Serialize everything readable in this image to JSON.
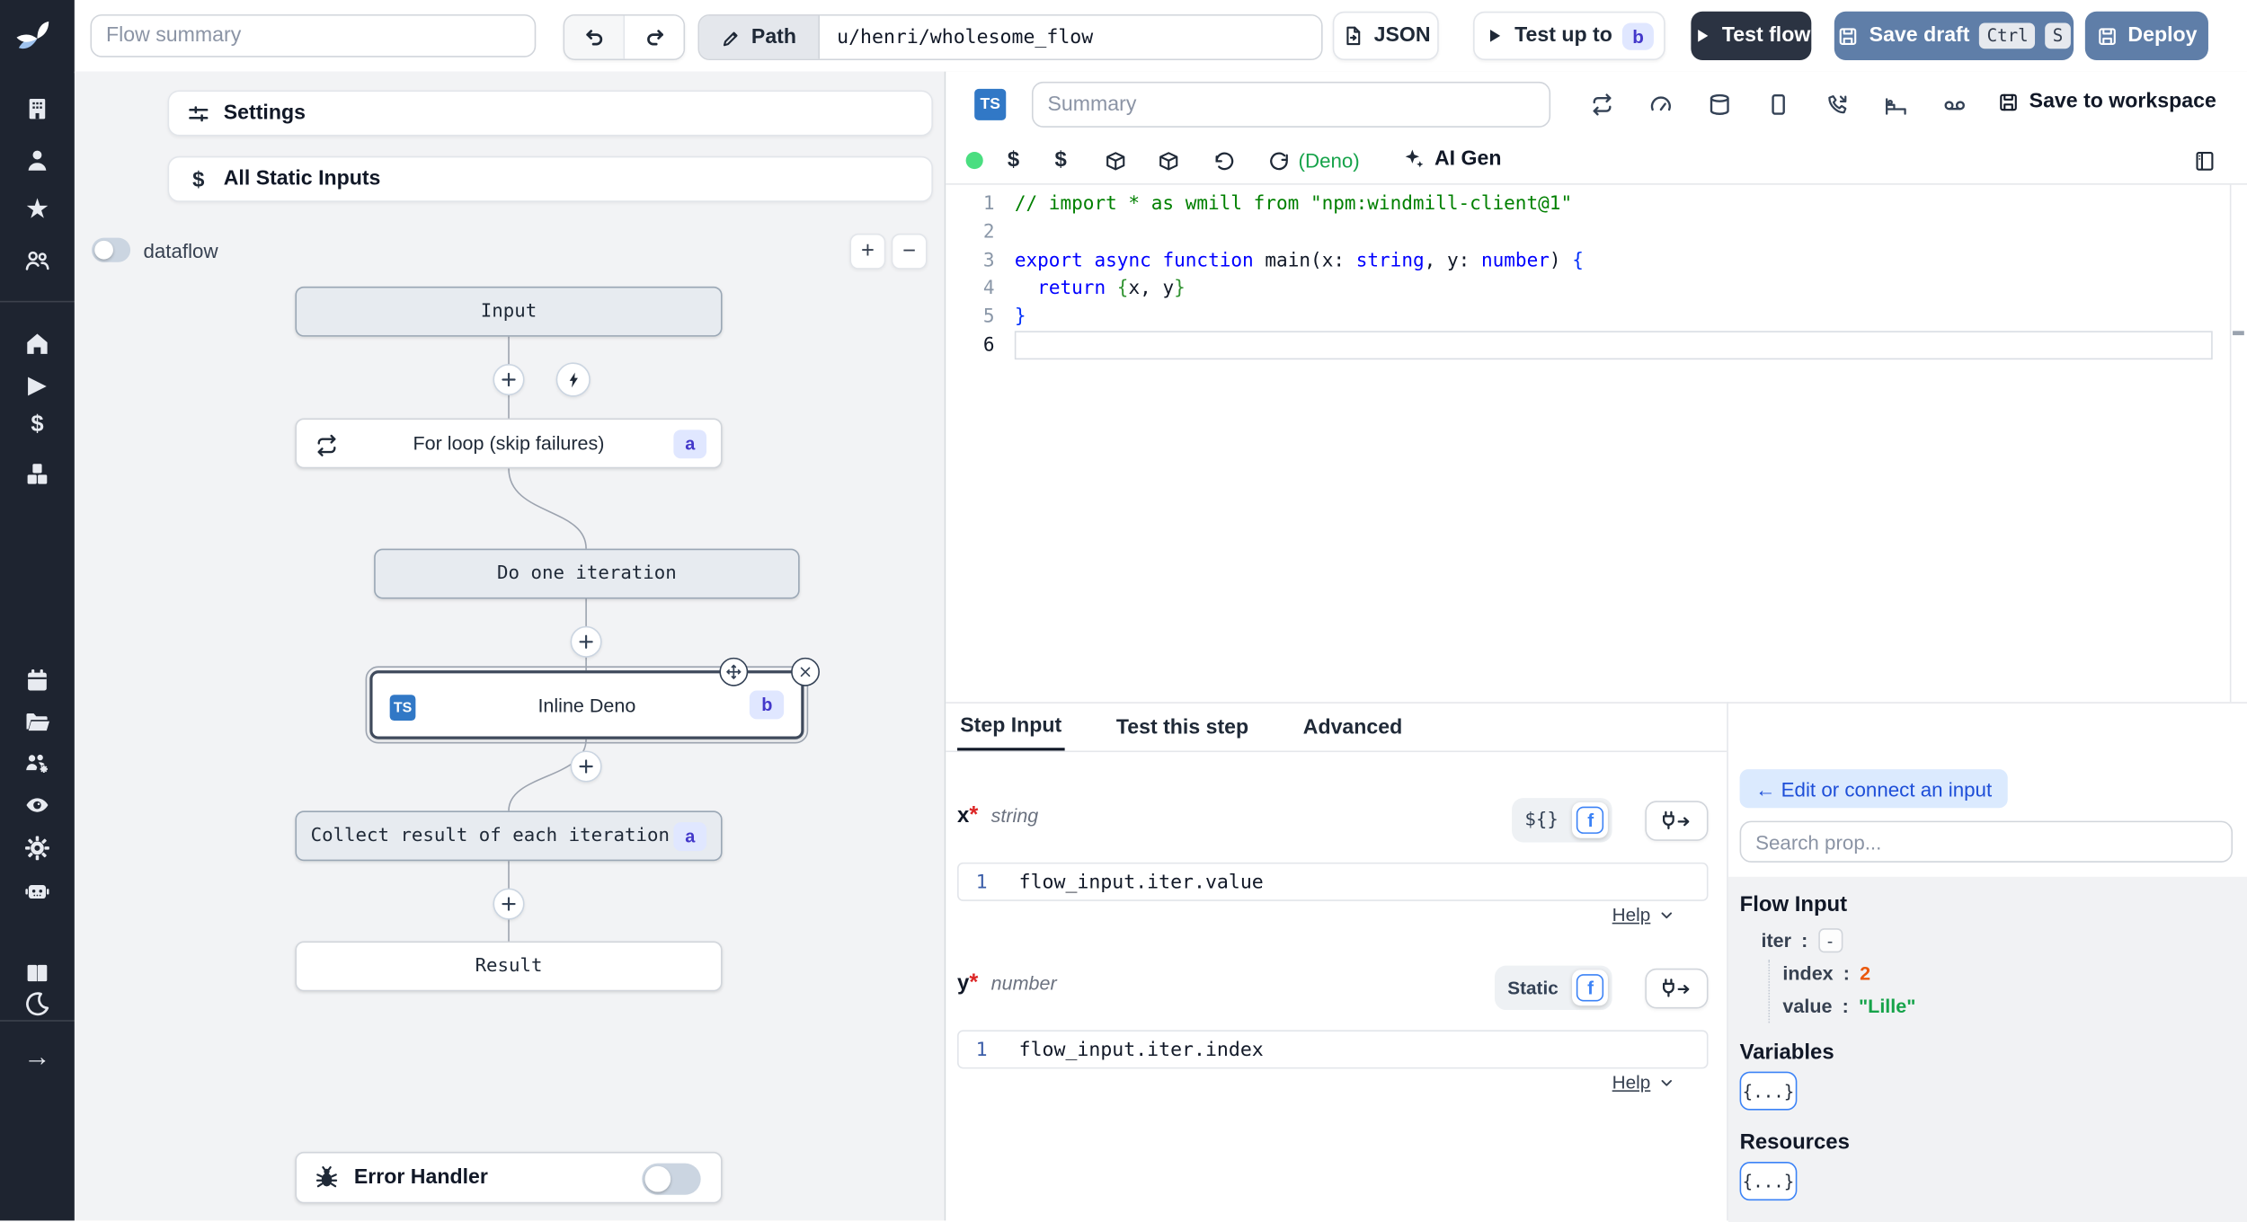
{
  "colors": {
    "accent_blue": "#3178c6",
    "button_blue": "#5f7ea8",
    "dark_button": "#2b3342",
    "badge_bg": "#e0e7ff",
    "badge_text": "#4338ca",
    "connect_bg": "#dbeafe",
    "connect_text": "#1d4ed8",
    "num_value": "#ea580c",
    "str_value": "#16a34a",
    "sidebar_bg": "#1e2430"
  },
  "topbar": {
    "flow_summary_placeholder": "Flow summary",
    "path_label": "Path",
    "path_value": "u/henri/wholesome_flow",
    "json_label": "JSON",
    "test_up_to_label": "Test up to",
    "test_up_to_badge": "b",
    "test_flow_label": "Test flow",
    "save_draft_label": "Save draft",
    "kbd": [
      "Ctrl",
      "S"
    ],
    "deploy_label": "Deploy"
  },
  "flow_panel": {
    "settings_label": "Settings",
    "static_inputs_label": "All Static Inputs",
    "dataflow_label": "dataflow",
    "zoom_in": "+",
    "zoom_out": "−",
    "nodes": {
      "input": "Input",
      "for_loop": "For loop (skip failures)",
      "for_loop_badge": "a",
      "do_one": "Do one iteration",
      "inline": "Inline Deno",
      "inline_badge": "b",
      "inline_lang": "TS",
      "collect": "Collect result of each iteration",
      "collect_badge": "a",
      "result": "Result"
    },
    "error_handler_label": "Error Handler"
  },
  "editor": {
    "lang_badge": "TS",
    "summary_placeholder": "Summary",
    "save_to_workspace": "Save to workspace",
    "runtime": "(Deno)",
    "ai_gen": "AI Gen",
    "code_lines": [
      {
        "n": "1",
        "tokens": [
          {
            "t": "// import * as wmill from \"npm:windmill-client@1\"",
            "c": "c-com"
          }
        ]
      },
      {
        "n": "2",
        "tokens": []
      },
      {
        "n": "3",
        "tokens": [
          {
            "t": "export",
            "c": "c-kw"
          },
          {
            "t": " ",
            "c": "c-pl"
          },
          {
            "t": "async",
            "c": "c-kw"
          },
          {
            "t": " ",
            "c": "c-pl"
          },
          {
            "t": "function",
            "c": "c-kw"
          },
          {
            "t": " main(x: ",
            "c": "c-pl"
          },
          {
            "t": "string",
            "c": "c-ty"
          },
          {
            "t": ", y: ",
            "c": "c-pl"
          },
          {
            "t": "number",
            "c": "c-ty"
          },
          {
            "t": ") ",
            "c": "c-pl"
          },
          {
            "t": "{",
            "c": "c-b1"
          }
        ]
      },
      {
        "n": "4",
        "tokens": [
          {
            "t": "  ",
            "c": "c-pl"
          },
          {
            "t": "return",
            "c": "c-kw"
          },
          {
            "t": " ",
            "c": "c-pl"
          },
          {
            "t": "{",
            "c": "c-b2"
          },
          {
            "t": "x, y",
            "c": "c-pl"
          },
          {
            "t": "}",
            "c": "c-b2"
          }
        ]
      },
      {
        "n": "5",
        "tokens": [
          {
            "t": "}",
            "c": "c-b1"
          }
        ]
      },
      {
        "n": "6",
        "tokens": [],
        "current": true
      }
    ]
  },
  "step_panel": {
    "tabs": [
      "Step Input",
      "Test this step",
      "Advanced"
    ],
    "fields": [
      {
        "name": "x",
        "req": "*",
        "type": "string",
        "mode": "${}",
        "fn": "f",
        "line_no": "1",
        "expr": "flow_input.iter.value",
        "help": "Help"
      },
      {
        "name": "y",
        "req": "*",
        "type": "number",
        "mode": "Static",
        "fn": "f",
        "line_no": "1",
        "expr": "flow_input.iter.index",
        "help": "Help"
      }
    ]
  },
  "prop_panel": {
    "edit_connect": "← Edit or connect an input",
    "search_placeholder": "Search prop...",
    "flow_input_title": "Flow Input",
    "colon": ":",
    "iter_key": "iter",
    "iter_collapse": "-",
    "rows": [
      {
        "key": "index",
        "value": "2"
      },
      {
        "key": "value",
        "value": "\"Lille\""
      }
    ],
    "variables_title": "Variables",
    "variables_button": "{...}",
    "resources_title": "Resources",
    "resources_button": "{...}"
  }
}
